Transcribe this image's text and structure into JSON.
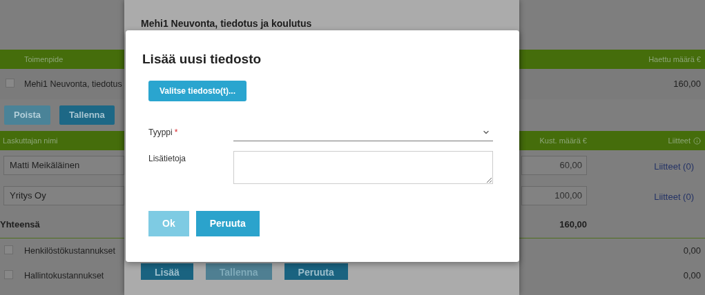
{
  "page": {
    "header": {
      "columns": [
        "Toimenpide",
        "Haettu määrä €"
      ]
    },
    "measure": {
      "checked": false,
      "name": "Mehi1 Neuvonta, tiedotus",
      "amount": "160,00"
    },
    "buttons": [
      {
        "label": "Poista",
        "disabled": true
      },
      {
        "label": "Tallenna",
        "disabled": false
      }
    ],
    "costs_header": {
      "columns": [
        "Laskuttajan nimi",
        "Kust. määrä €",
        "Liitteet"
      ]
    },
    "costs": [
      {
        "name": "Matti Meikäläinen",
        "amount": "60,00",
        "attachments": "Liitteet (0)"
      },
      {
        "name": "Yritys Oy",
        "amount": "100,00",
        "attachments": "Liitteet (0)"
      }
    ],
    "total": {
      "label": "Yhteensä",
      "amount": "160,00"
    },
    "categories": [
      {
        "name": "Henkilöstökustannukset",
        "checked": false,
        "amount": "0,00"
      },
      {
        "name": "Hallintokustannukset",
        "checked": false,
        "amount": "0,00"
      }
    ]
  },
  "dialog": {
    "title": "Mehi1 Neuvonta, tiedotus ja koulutus",
    "buttons": [
      {
        "label": "Lisää",
        "disabled": false
      },
      {
        "label": "Tallenna",
        "disabled": true
      },
      {
        "label": "Peruuta",
        "disabled": false
      }
    ]
  },
  "file_dialog": {
    "title": "Lisää uusi tiedosto",
    "choose_button": "Valitse tiedosto(t)...",
    "fields": [
      {
        "kind": "select",
        "label": "Tyyppi",
        "required_mark": "*"
      },
      {
        "kind": "textarea",
        "label": "Lisätietoja"
      }
    ],
    "buttons": [
      {
        "label": "Ok",
        "disabled": true
      },
      {
        "label": "Peruuta",
        "disabled": false
      }
    ]
  }
}
